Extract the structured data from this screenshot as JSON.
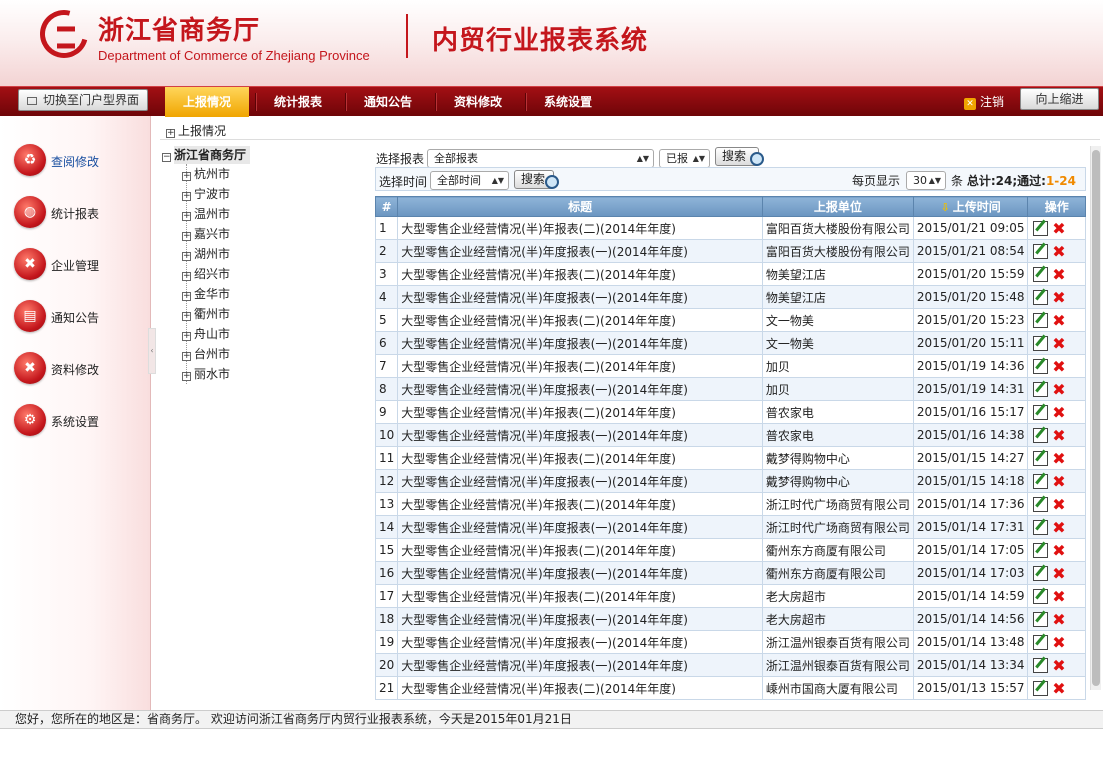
{
  "header": {
    "org_cn": "浙江省商务厅",
    "org_en": "Department of Commerce of Zhejiang Province",
    "system_title": "内贸行业报表系统"
  },
  "nav": {
    "switch_label": "切换至门户型界面",
    "items": [
      "上报情况",
      "统计报表",
      "通知公告",
      "资料修改",
      "系统设置"
    ],
    "active_index": 0,
    "logout_label": "注销",
    "collapse_label": "向上缩进"
  },
  "sidebar": {
    "items": [
      {
        "label": "查阅修改",
        "icon": "recycle-icon"
      },
      {
        "label": "统计报表",
        "icon": "globe-icon"
      },
      {
        "label": "企业管理",
        "icon": "tools-icon"
      },
      {
        "label": "通知公告",
        "icon": "document-icon"
      },
      {
        "label": "资料修改",
        "icon": "wrench-icon"
      },
      {
        "label": "系统设置",
        "icon": "gears-icon"
      }
    ],
    "active_index": 0
  },
  "breadcrumb": "上报情况",
  "tree": {
    "root": "浙江省商务厅",
    "nodes": [
      "杭州市",
      "宁波市",
      "温州市",
      "嘉兴市",
      "湖州市",
      "绍兴市",
      "金华市",
      "衢州市",
      "舟山市",
      "台州市",
      "丽水市"
    ]
  },
  "filters": {
    "report_label": "选择报表",
    "report_value": "全部报表",
    "status_value": "已报",
    "search_label": "搜索",
    "time_label": "选择时间",
    "time_value": "全部时间",
    "per_page_label": "每页显示",
    "per_page_value": "30",
    "unit_label": "条",
    "total_text": "总计:24",
    "pass_text": ";通过:",
    "range_text": "1-24"
  },
  "table": {
    "headers": {
      "num": "#",
      "title": "标题",
      "unit": "上报单位",
      "time": "上传时间",
      "action": "操作"
    },
    "rows": [
      {
        "n": "1",
        "title": "大型零售企业经营情况(半)年报表(二)(2014年年度)",
        "unit": "富阳百货大楼股份有限公司",
        "time": "2015/01/21 09:05"
      },
      {
        "n": "2",
        "title": "大型零售企业经营情况(半)年度报表(一)(2014年年度)",
        "unit": "富阳百货大楼股份有限公司",
        "time": "2015/01/21 08:54"
      },
      {
        "n": "3",
        "title": "大型零售企业经营情况(半)年报表(二)(2014年年度)",
        "unit": "物美望江店",
        "time": "2015/01/20 15:59"
      },
      {
        "n": "4",
        "title": "大型零售企业经营情况(半)年度报表(一)(2014年年度)",
        "unit": "物美望江店",
        "time": "2015/01/20 15:48"
      },
      {
        "n": "5",
        "title": "大型零售企业经营情况(半)年报表(二)(2014年年度)",
        "unit": "文一物美",
        "time": "2015/01/20 15:23"
      },
      {
        "n": "6",
        "title": "大型零售企业经营情况(半)年度报表(一)(2014年年度)",
        "unit": "文一物美",
        "time": "2015/01/20 15:11"
      },
      {
        "n": "7",
        "title": "大型零售企业经营情况(半)年报表(二)(2014年年度)",
        "unit": "加贝",
        "time": "2015/01/19 14:36"
      },
      {
        "n": "8",
        "title": "大型零售企业经营情况(半)年度报表(一)(2014年年度)",
        "unit": "加贝",
        "time": "2015/01/19 14:31"
      },
      {
        "n": "9",
        "title": "大型零售企业经营情况(半)年报表(二)(2014年年度)",
        "unit": "普农家电",
        "time": "2015/01/16 15:17"
      },
      {
        "n": "10",
        "title": "大型零售企业经营情况(半)年度报表(一)(2014年年度)",
        "unit": "普农家电",
        "time": "2015/01/16 14:38"
      },
      {
        "n": "11",
        "title": "大型零售企业经营情况(半)年报表(二)(2014年年度)",
        "unit": "戴梦得购物中心",
        "time": "2015/01/15 14:27"
      },
      {
        "n": "12",
        "title": "大型零售企业经营情况(半)年度报表(一)(2014年年度)",
        "unit": "戴梦得购物中心",
        "time": "2015/01/15 14:18"
      },
      {
        "n": "13",
        "title": "大型零售企业经营情况(半)年报表(二)(2014年年度)",
        "unit": "浙江时代广场商贸有限公司",
        "time": "2015/01/14 17:36"
      },
      {
        "n": "14",
        "title": "大型零售企业经营情况(半)年度报表(一)(2014年年度)",
        "unit": "浙江时代广场商贸有限公司",
        "time": "2015/01/14 17:31"
      },
      {
        "n": "15",
        "title": "大型零售企业经营情况(半)年报表(二)(2014年年度)",
        "unit": "衢州东方商厦有限公司",
        "time": "2015/01/14 17:05"
      },
      {
        "n": "16",
        "title": "大型零售企业经营情况(半)年度报表(一)(2014年年度)",
        "unit": "衢州东方商厦有限公司",
        "time": "2015/01/14 17:03"
      },
      {
        "n": "17",
        "title": "大型零售企业经营情况(半)年报表(二)(2014年年度)",
        "unit": "老大房超市",
        "time": "2015/01/14 14:59"
      },
      {
        "n": "18",
        "title": "大型零售企业经营情况(半)年度报表(一)(2014年年度)",
        "unit": "老大房超市",
        "time": "2015/01/14 14:56"
      },
      {
        "n": "19",
        "title": "大型零售企业经营情况(半)年度报表(一)(2014年年度)",
        "unit": "浙江温州银泰百货有限公司",
        "time": "2015/01/14 13:48"
      },
      {
        "n": "20",
        "title": "大型零售企业经营情况(半)年度报表(一)(2014年年度)",
        "unit": "浙江温州银泰百货有限公司",
        "time": "2015/01/14 13:34"
      },
      {
        "n": "21",
        "title": "大型零售企业经营情况(半)年报表(二)(2014年年度)",
        "unit": "嵊州市国商大厦有限公司",
        "time": "2015/01/13 15:57"
      }
    ]
  },
  "status": "您好，您所在的地区是：省商务厅。   欢迎访问浙江省商务厅内贸行业报表系统，今天是2015年01月21日"
}
